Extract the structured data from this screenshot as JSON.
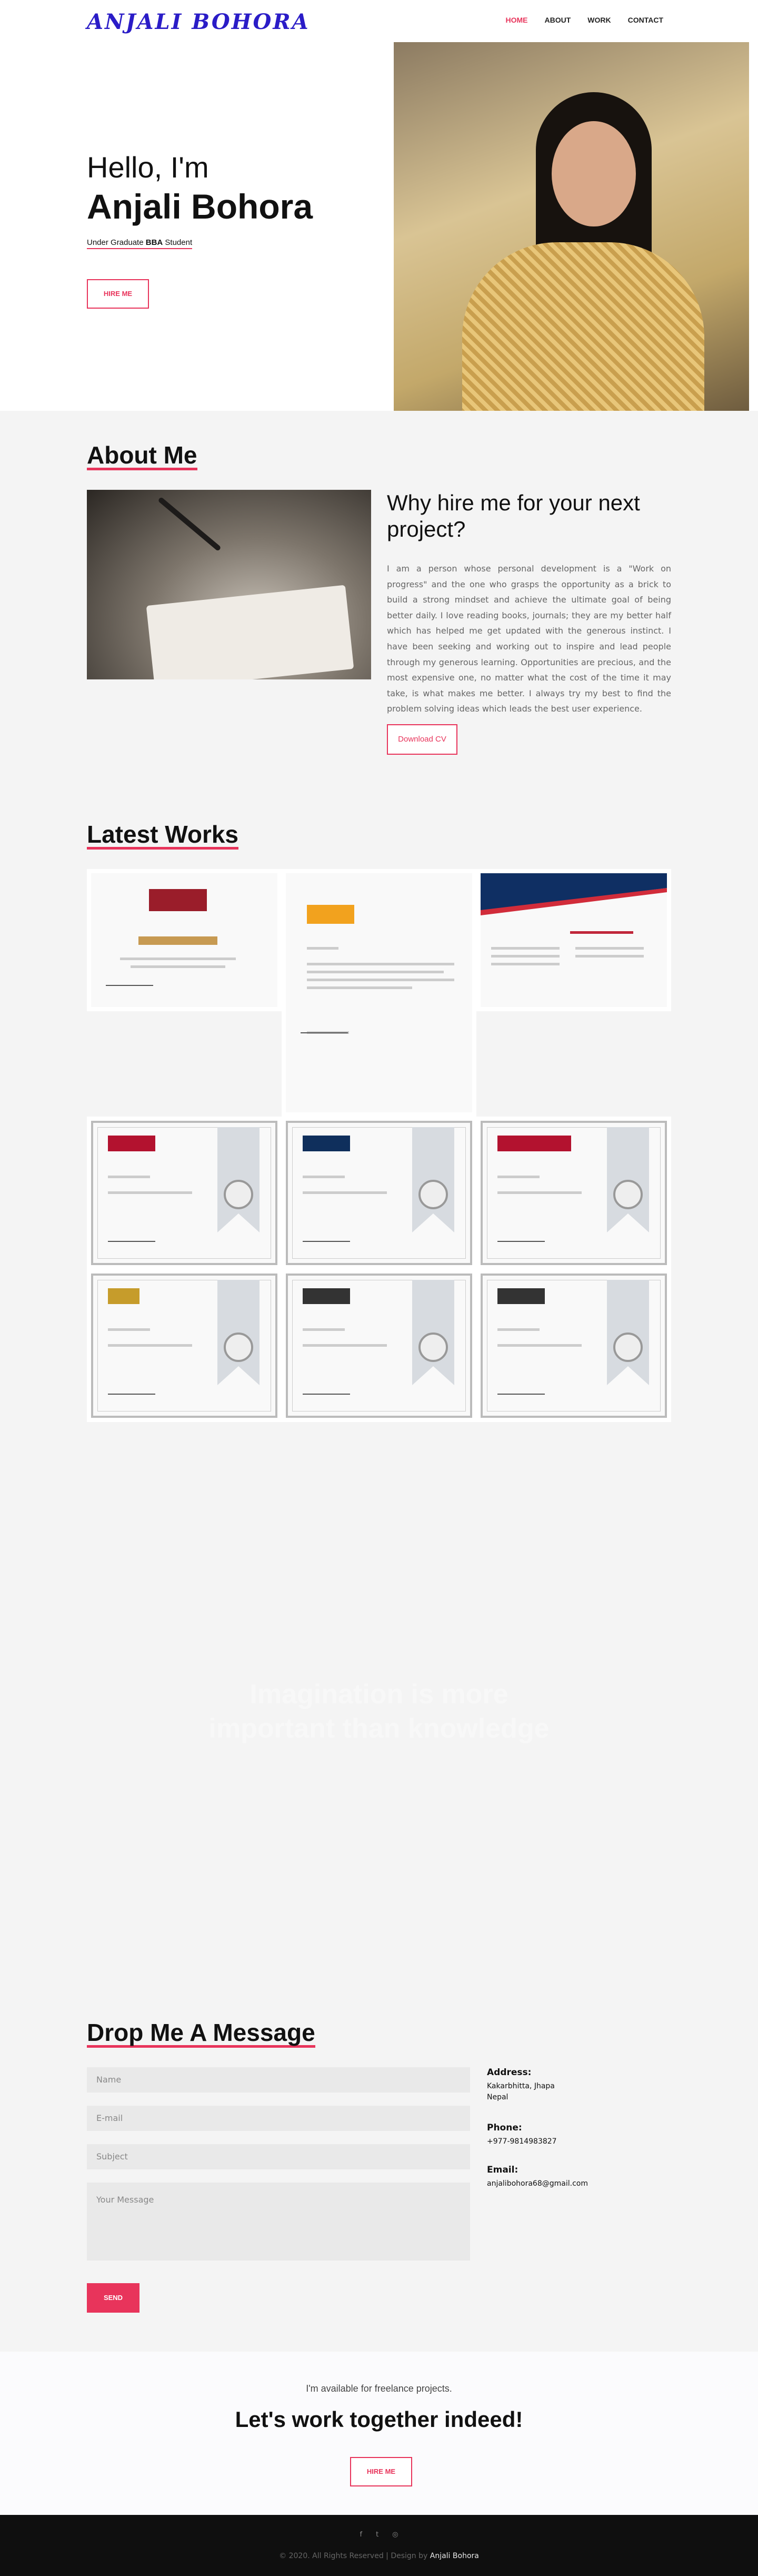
{
  "nav": {
    "logo": "ANJALI BOHORA",
    "items": [
      {
        "label": "HOME",
        "active": true
      },
      {
        "label": "ABOUT",
        "active": false
      },
      {
        "label": "WORK",
        "active": false
      },
      {
        "label": "CONTACT",
        "active": false
      }
    ]
  },
  "hero": {
    "greeting": "Hello, I'm",
    "name": "Anjali Bohora",
    "subtitle_pre": "Under Graduate ",
    "subtitle_bold": "BBA",
    "subtitle_post": " Student",
    "hire_label": "HIRE ME"
  },
  "about": {
    "title": "About Me",
    "why_title": "Why hire me for your next project?",
    "description": "I am a person whose personal development is a \"Work on progress\" and the one who grasps the opportunity as a brick to build a strong mindset and achieve the ultimate goal of being better daily. I love reading books, journals; they are my better half which has helped me get updated with the generous instinct. I have been seeking and working out to inspire and lead people through my generous learning. Opportunities are precious, and the most expensive one, no matter what the cost of the time it may take, is what makes me better. I always try my best to find the problem solving ideas which leads the best user experience.",
    "cv_label": "Download CV"
  },
  "works": {
    "title": "Latest Works"
  },
  "quote": {
    "line1": "Imagination is more",
    "line2": "important than knowledge"
  },
  "contact": {
    "title": "Drop Me A Message",
    "name_placeholder": "Name",
    "email_placeholder": "E-mail",
    "subject_placeholder": "Subject",
    "message_placeholder": "Your Message",
    "send_label": "SEND",
    "address_label": "Address:",
    "address_line1": "Kakarbhitta, Jhapa",
    "address_line2": "Nepal",
    "phone_label": "Phone:",
    "phone_value": "+977-9814983827",
    "email_label": "Email:",
    "email_value": "anjalibohora68@gmail.com"
  },
  "freelance": {
    "small": "I'm available for freelance projects.",
    "big": "Let's work together indeed!",
    "hire_label": "HIRE ME"
  },
  "footer": {
    "social": [
      {
        "icon": "facebook-icon",
        "glyph": "f"
      },
      {
        "icon": "twitter-icon",
        "glyph": "t"
      },
      {
        "icon": "instagram-icon",
        "glyph": "◎"
      }
    ],
    "copy_pre": "© 2020. All Rights Reserved | Design by ",
    "copy_name": "Anjali Bohora"
  },
  "colors": {
    "accent": "#e8345b",
    "logo": "#2a1cc7"
  }
}
